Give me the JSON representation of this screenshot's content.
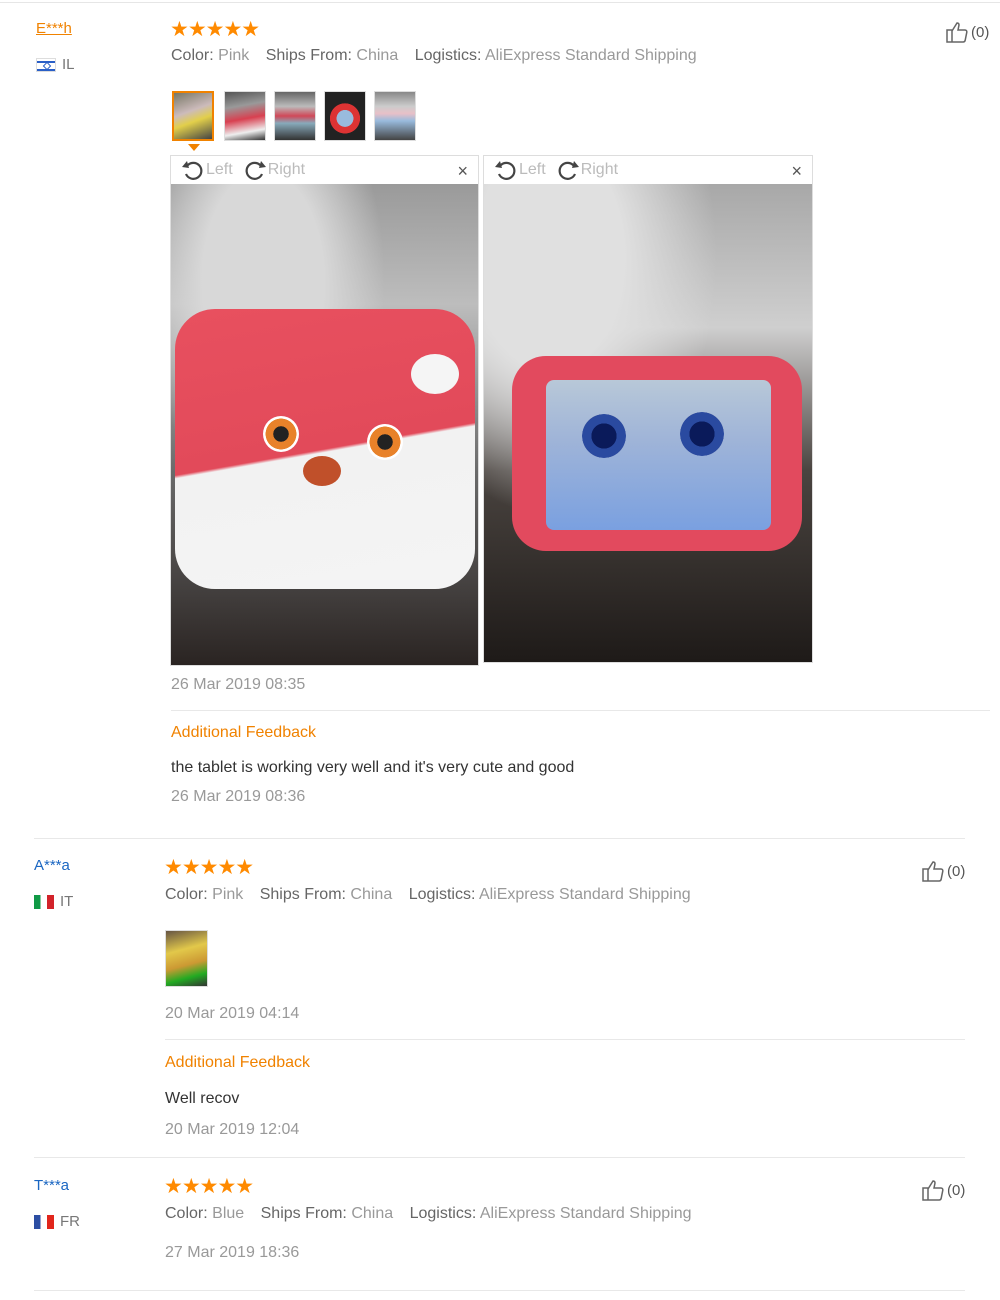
{
  "reviews": [
    {
      "user": "E***h",
      "country": "IL",
      "stars": "★★★★★",
      "color_label": "Color:",
      "color": "Pink",
      "ships_label": "Ships From:",
      "ships": "China",
      "logistics_label": "Logistics:",
      "logistics": "AliExpress Standard Shipping",
      "likes": "(0)",
      "date": "26 Mar 2019 08:35",
      "additional_label": "Additional Feedback",
      "additional_text": "the tablet is working very well and it's very cute and good",
      "additional_date": "26 Mar 2019 08:36",
      "viewer": {
        "rotate_left": "Left",
        "rotate_right": "Right",
        "close": "×"
      }
    },
    {
      "user": "A***a",
      "country": "IT",
      "stars": "★★★★★",
      "color_label": "Color:",
      "color": "Pink",
      "ships_label": "Ships From:",
      "ships": "China",
      "logistics_label": "Logistics:",
      "logistics": "AliExpress Standard Shipping",
      "likes": "(0)",
      "date": "20 Mar 2019 04:14",
      "additional_label": "Additional Feedback",
      "additional_text": "Well recov",
      "additional_date": "20 Mar 2019 12:04"
    },
    {
      "user": "T***a",
      "country": "FR",
      "stars": "★★★★★",
      "color_label": "Color:",
      "color": "Blue",
      "ships_label": "Ships From:",
      "ships": "China",
      "logistics_label": "Logistics:",
      "logistics": "AliExpress Standard Shipping",
      "likes": "(0)",
      "date": "27 Mar 2019 18:36"
    }
  ],
  "icons": {
    "like": "thumbs-up-icon",
    "rotate_left": "rotate-left-icon",
    "rotate_right": "rotate-right-icon",
    "close": "close-icon"
  },
  "colors": {
    "accent": "#f08200",
    "star": "#ff8a00",
    "link": "#1a66c2"
  }
}
